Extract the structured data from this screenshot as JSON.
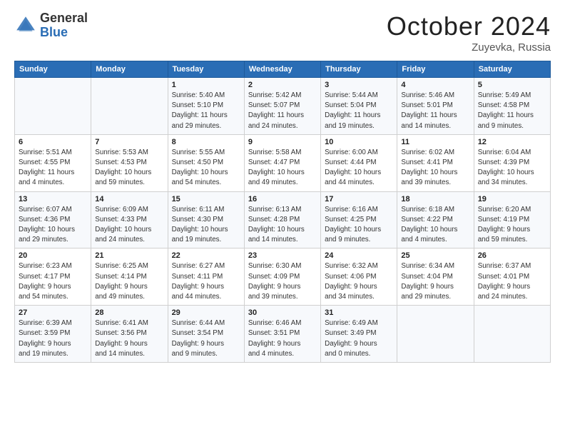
{
  "header": {
    "logo_general": "General",
    "logo_blue": "Blue",
    "title": "October 2024",
    "location": "Zuyevka, Russia"
  },
  "columns": [
    "Sunday",
    "Monday",
    "Tuesday",
    "Wednesday",
    "Thursday",
    "Friday",
    "Saturday"
  ],
  "weeks": [
    [
      {
        "day": "",
        "info": ""
      },
      {
        "day": "",
        "info": ""
      },
      {
        "day": "1",
        "info": "Sunrise: 5:40 AM\nSunset: 5:10 PM\nDaylight: 11 hours\nand 29 minutes."
      },
      {
        "day": "2",
        "info": "Sunrise: 5:42 AM\nSunset: 5:07 PM\nDaylight: 11 hours\nand 24 minutes."
      },
      {
        "day": "3",
        "info": "Sunrise: 5:44 AM\nSunset: 5:04 PM\nDaylight: 11 hours\nand 19 minutes."
      },
      {
        "day": "4",
        "info": "Sunrise: 5:46 AM\nSunset: 5:01 PM\nDaylight: 11 hours\nand 14 minutes."
      },
      {
        "day": "5",
        "info": "Sunrise: 5:49 AM\nSunset: 4:58 PM\nDaylight: 11 hours\nand 9 minutes."
      }
    ],
    [
      {
        "day": "6",
        "info": "Sunrise: 5:51 AM\nSunset: 4:55 PM\nDaylight: 11 hours\nand 4 minutes."
      },
      {
        "day": "7",
        "info": "Sunrise: 5:53 AM\nSunset: 4:53 PM\nDaylight: 10 hours\nand 59 minutes."
      },
      {
        "day": "8",
        "info": "Sunrise: 5:55 AM\nSunset: 4:50 PM\nDaylight: 10 hours\nand 54 minutes."
      },
      {
        "day": "9",
        "info": "Sunrise: 5:58 AM\nSunset: 4:47 PM\nDaylight: 10 hours\nand 49 minutes."
      },
      {
        "day": "10",
        "info": "Sunrise: 6:00 AM\nSunset: 4:44 PM\nDaylight: 10 hours\nand 44 minutes."
      },
      {
        "day": "11",
        "info": "Sunrise: 6:02 AM\nSunset: 4:41 PM\nDaylight: 10 hours\nand 39 minutes."
      },
      {
        "day": "12",
        "info": "Sunrise: 6:04 AM\nSunset: 4:39 PM\nDaylight: 10 hours\nand 34 minutes."
      }
    ],
    [
      {
        "day": "13",
        "info": "Sunrise: 6:07 AM\nSunset: 4:36 PM\nDaylight: 10 hours\nand 29 minutes."
      },
      {
        "day": "14",
        "info": "Sunrise: 6:09 AM\nSunset: 4:33 PM\nDaylight: 10 hours\nand 24 minutes."
      },
      {
        "day": "15",
        "info": "Sunrise: 6:11 AM\nSunset: 4:30 PM\nDaylight: 10 hours\nand 19 minutes."
      },
      {
        "day": "16",
        "info": "Sunrise: 6:13 AM\nSunset: 4:28 PM\nDaylight: 10 hours\nand 14 minutes."
      },
      {
        "day": "17",
        "info": "Sunrise: 6:16 AM\nSunset: 4:25 PM\nDaylight: 10 hours\nand 9 minutes."
      },
      {
        "day": "18",
        "info": "Sunrise: 6:18 AM\nSunset: 4:22 PM\nDaylight: 10 hours\nand 4 minutes."
      },
      {
        "day": "19",
        "info": "Sunrise: 6:20 AM\nSunset: 4:19 PM\nDaylight: 9 hours\nand 59 minutes."
      }
    ],
    [
      {
        "day": "20",
        "info": "Sunrise: 6:23 AM\nSunset: 4:17 PM\nDaylight: 9 hours\nand 54 minutes."
      },
      {
        "day": "21",
        "info": "Sunrise: 6:25 AM\nSunset: 4:14 PM\nDaylight: 9 hours\nand 49 minutes."
      },
      {
        "day": "22",
        "info": "Sunrise: 6:27 AM\nSunset: 4:11 PM\nDaylight: 9 hours\nand 44 minutes."
      },
      {
        "day": "23",
        "info": "Sunrise: 6:30 AM\nSunset: 4:09 PM\nDaylight: 9 hours\nand 39 minutes."
      },
      {
        "day": "24",
        "info": "Sunrise: 6:32 AM\nSunset: 4:06 PM\nDaylight: 9 hours\nand 34 minutes."
      },
      {
        "day": "25",
        "info": "Sunrise: 6:34 AM\nSunset: 4:04 PM\nDaylight: 9 hours\nand 29 minutes."
      },
      {
        "day": "26",
        "info": "Sunrise: 6:37 AM\nSunset: 4:01 PM\nDaylight: 9 hours\nand 24 minutes."
      }
    ],
    [
      {
        "day": "27",
        "info": "Sunrise: 6:39 AM\nSunset: 3:59 PM\nDaylight: 9 hours\nand 19 minutes."
      },
      {
        "day": "28",
        "info": "Sunrise: 6:41 AM\nSunset: 3:56 PM\nDaylight: 9 hours\nand 14 minutes."
      },
      {
        "day": "29",
        "info": "Sunrise: 6:44 AM\nSunset: 3:54 PM\nDaylight: 9 hours\nand 9 minutes."
      },
      {
        "day": "30",
        "info": "Sunrise: 6:46 AM\nSunset: 3:51 PM\nDaylight: 9 hours\nand 4 minutes."
      },
      {
        "day": "31",
        "info": "Sunrise: 6:49 AM\nSunset: 3:49 PM\nDaylight: 9 hours\nand 0 minutes."
      },
      {
        "day": "",
        "info": ""
      },
      {
        "day": "",
        "info": ""
      }
    ]
  ]
}
